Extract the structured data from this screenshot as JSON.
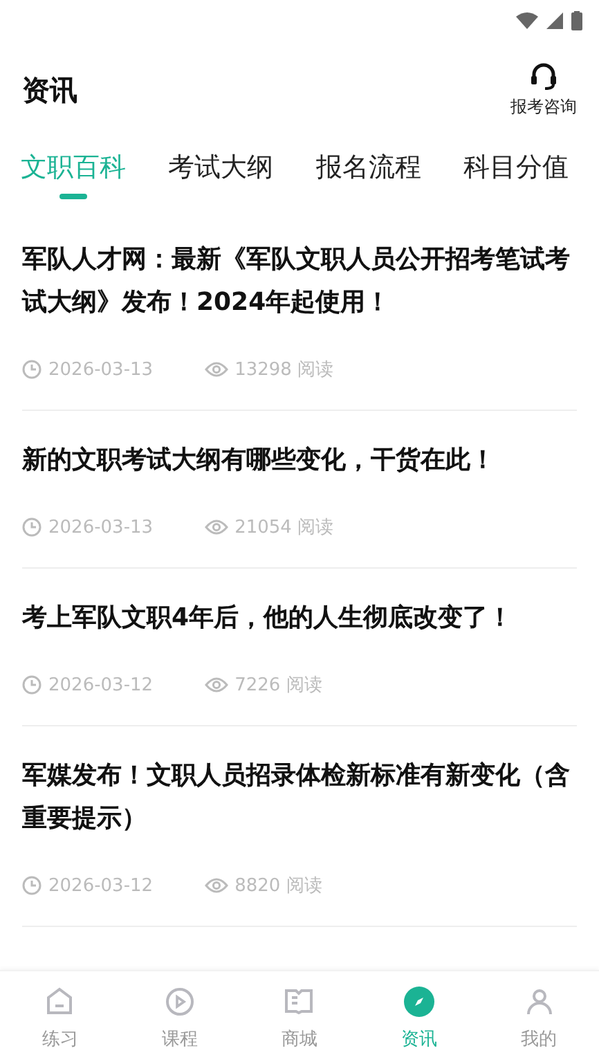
{
  "header": {
    "title": "资讯",
    "action": "报考咨询"
  },
  "tabs": [
    {
      "label": "文职百科",
      "selected": true
    },
    {
      "label": "考试大纲",
      "selected": false
    },
    {
      "label": "报名流程",
      "selected": false
    },
    {
      "label": "科目分值",
      "selected": false
    }
  ],
  "articles": [
    {
      "title": "军队人才网：最新《军队文职人员公开招考笔试考试大纲》发布！2024年起使用！",
      "date": "2026-03-13",
      "views": "13298 阅读"
    },
    {
      "title": "新的文职考试大纲有哪些变化，干货在此！",
      "date": "2026-03-13",
      "views": "21054 阅读"
    },
    {
      "title": "考上军队文职4年后，他的人生彻底改变了！",
      "date": "2026-03-12",
      "views": "7226 阅读"
    },
    {
      "title": "军媒发布！文职人员招录体检新标准有新变化（含重要提示）",
      "date": "2026-03-12",
      "views": "8820 阅读"
    }
  ],
  "nav": [
    {
      "label": "练习",
      "kind": "home",
      "selected": false
    },
    {
      "label": "课程",
      "kind": "play",
      "selected": false
    },
    {
      "label": "商城",
      "kind": "book",
      "selected": false
    },
    {
      "label": "资讯",
      "kind": "compass",
      "selected": true
    },
    {
      "label": "我的",
      "kind": "user",
      "selected": false
    }
  ]
}
